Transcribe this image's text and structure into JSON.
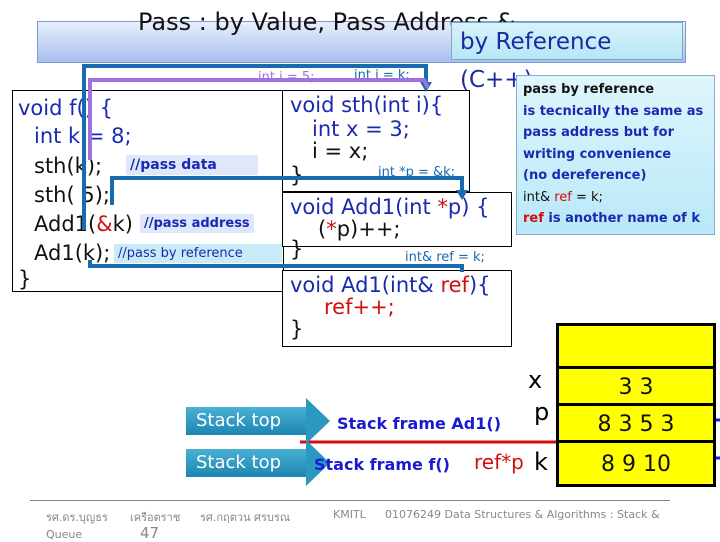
{
  "title": {
    "main": "Pass :  by Value,    Pass Address &",
    "ref": "by Reference (C++)"
  },
  "labels": {
    "int_i_5": "int i = 5;",
    "int_i_k": "int i = k;",
    "int_p": "int *p = &k;",
    "int_ref": "int& ref = k;"
  },
  "f_code": {
    "l1": "void f() {",
    "l2": "int k = 8;",
    "l3": "sth(k);",
    "l4": "sth( 5);",
    "l5a": "Add1(",
    "l5b": "&",
    "l5c": "k)",
    "l6": "Ad1(k);",
    "l7": "}",
    "c1": "//pass data",
    "c2": "//pass address",
    "c3": "//pass by reference"
  },
  "sth_code": {
    "l1": "void sth(int i){",
    "l2": "int x = 3;",
    "l3": "i = x;",
    "l4": "}"
  },
  "add1_code": {
    "l1a": "void Add1(int ",
    "l1b": "*",
    "l1c": "p) {",
    "l2a": "(",
    "l2b": "*",
    "l2c": "p)++;",
    "l3": "}"
  },
  "ad1_code": {
    "l1a": "void Ad1(int& ",
    "l1b": "ref",
    "l1c": "){",
    "l2": "ref++;",
    "l3": "}"
  },
  "info": {
    "l1": "pass by reference",
    "l2": "is tecnically the same as",
    "l3": "pass address but for",
    "l4": "writing convenience",
    "l5": "(no dereference)",
    "l6a": "int& ",
    "l6b": "ref",
    "l6c": " = k;",
    "l7a": "ref",
    "l7b": " is another name of k"
  },
  "stack": {
    "x_label": "x",
    "p_label": "p",
    "k_label": "k",
    "x_vals": "3  3",
    "p_vals": "8 3 5 3",
    "k_vals": "8 9 10"
  },
  "stack_top_1": "Stack top",
  "stack_top_2": "Stack top",
  "frame_upper": "Stack frame Ad1()",
  "frame_lower": "Stack frame f()",
  "ref_star_p": "ref*p",
  "footer": {
    "a1": "รศ.ดร.บุญธร",
    "a2": "เครือตราช",
    "a3": "รศ.กฤตวน  ศรบรณ",
    "org": "KMITL",
    "course": "01076249 Data Structures & Algorithms : Stack &",
    "topic": "Queue",
    "page": "47"
  },
  "colors": {
    "blue_arrow": "#1a6ab0",
    "purple_arrow": "#a070e0",
    "red": "#d01010",
    "stack_fill": "#ffff00"
  }
}
